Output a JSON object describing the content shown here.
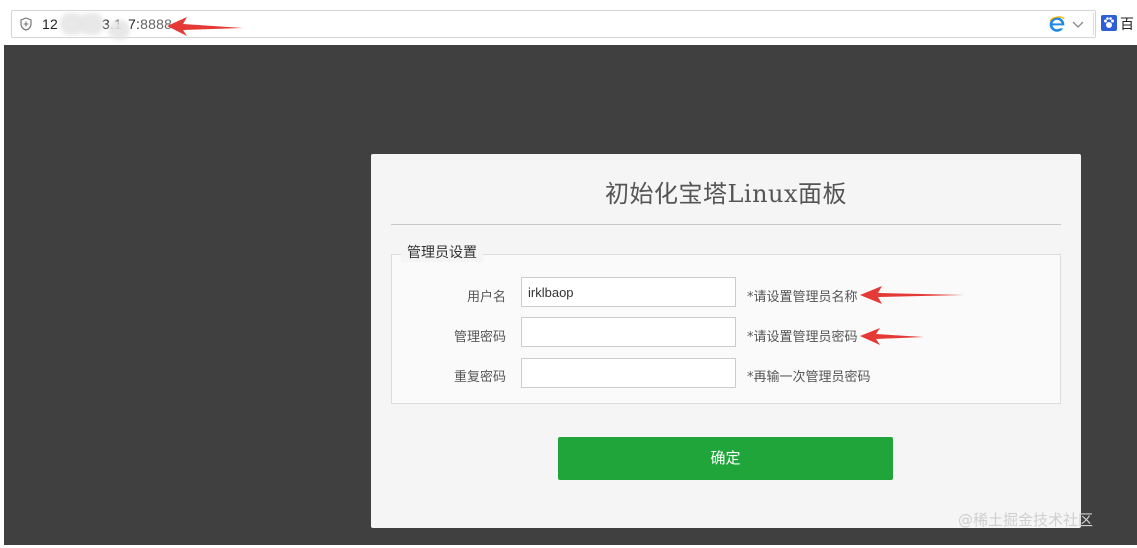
{
  "browser": {
    "url_visible": "12 3.1 7:",
    "url_prefix": "12",
    "url_middle": "3.1",
    "url_after": "7:",
    "url_port": "8888",
    "search_engine_label": "百"
  },
  "dialog": {
    "title": "初始化宝塔Linux面板",
    "section_legend": "管理员设置",
    "fields": [
      {
        "label": "用户名",
        "value": "irklbaop",
        "hint": "*请设置管理员名称"
      },
      {
        "label": "管理密码",
        "value": "",
        "hint": "*请设置管理员密码"
      },
      {
        "label": "重复密码",
        "value": "",
        "hint": "*再输一次管理员密码"
      }
    ],
    "submit_label": "确定"
  },
  "watermark": "@稀土掘金技术社区",
  "colors": {
    "page_background": "#404040",
    "dialog_background": "#f5f5f5",
    "submit_button": "#20a53a",
    "annotation_arrow": "#e53935"
  },
  "icons": {
    "address_shield": "shield-icon",
    "browser_engine": "ie-icon",
    "address_dropdown": "chevron-down-icon",
    "search_engine": "baidu-paw-icon"
  }
}
